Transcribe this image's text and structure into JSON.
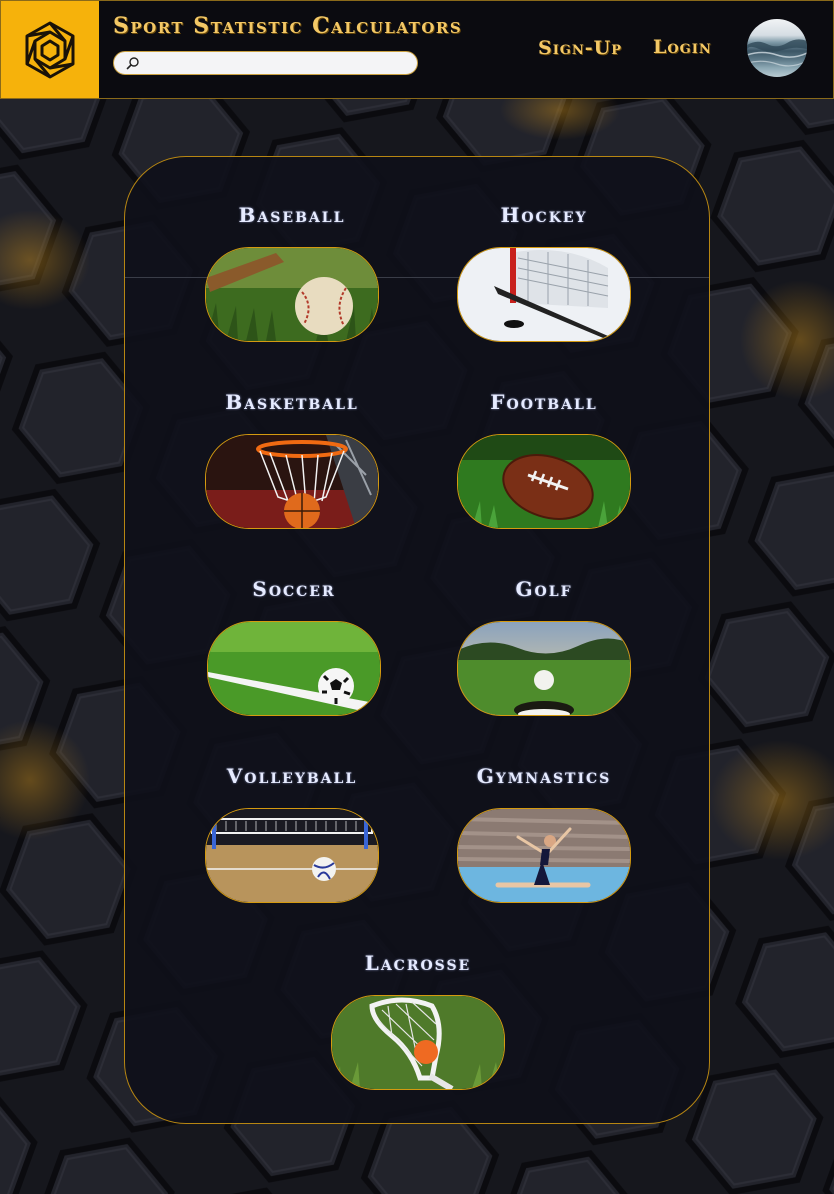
{
  "header": {
    "title": "Sport Statistic Calculators",
    "search_placeholder": "",
    "signup_label": "Sign-Up",
    "login_label": "Login",
    "logo_icon": "hexagon-spiral-logo",
    "avatar_icon": "ocean-wave-avatar"
  },
  "colors": {
    "accent": "#f6b20b",
    "title_text": "#f3c866",
    "sport_text": "#e6ebff",
    "panel_border": "#b78612",
    "background": "#15161c"
  },
  "sports": [
    {
      "name": "Baseball",
      "image": "baseball-on-grass"
    },
    {
      "name": "Hockey",
      "image": "hockey-stick-and-net"
    },
    {
      "name": "Basketball",
      "image": "basketball-in-hoop"
    },
    {
      "name": "Football",
      "image": "football-on-grass"
    },
    {
      "name": "Soccer",
      "image": "soccer-ball-on-field"
    },
    {
      "name": "Golf",
      "image": "golf-ball-at-hole"
    },
    {
      "name": "Volleyball",
      "image": "volleyball-court"
    },
    {
      "name": "Gymnastics",
      "image": "gymnast-split"
    },
    {
      "name": "Lacrosse",
      "image": "lacrosse-stick-and-ball"
    }
  ]
}
